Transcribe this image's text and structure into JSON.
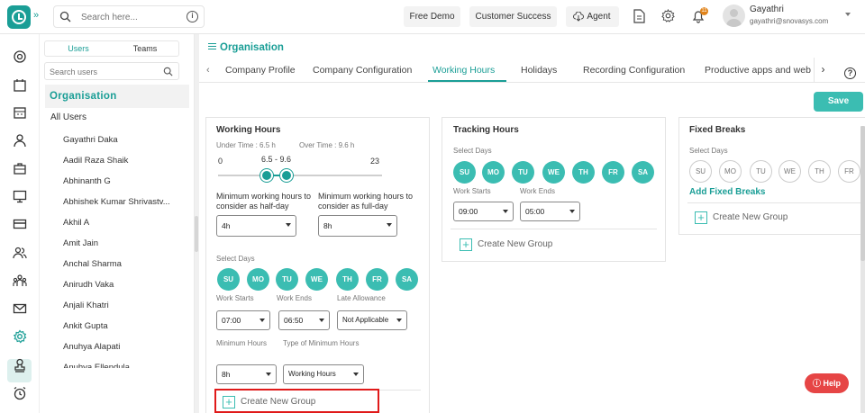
{
  "header": {
    "search_placeholder": "Search here...",
    "buttons": [
      "Free Demo",
      "Customer Success",
      "Agent"
    ],
    "notification_count": "11",
    "user_name": "Gayathri",
    "user_email": "gayathri@snovasys.com"
  },
  "sidebar": {
    "tabs": [
      "Users",
      "Teams"
    ],
    "search_placeholder": "Search users",
    "org_label": "Organisation",
    "all_users_label": "All Users",
    "users": [
      "Gayathri Daka",
      "Aadil Raza Shaik",
      "Abhinanth G",
      "Abhishek Kumar Shrivastv...",
      "Akhil A",
      "Amit Jain",
      "Anchal Sharma",
      "Anirudh Vaka",
      "Anjali Khatri",
      "Ankit Gupta",
      "Anuhya Alapati",
      "Anuhya Ellendula"
    ]
  },
  "page": {
    "title": "Organisation",
    "tabs": [
      "Company Profile",
      "Company Configuration",
      "Working Hours",
      "Holidays",
      "Recording Configuration",
      "Productive apps and web"
    ],
    "active_tab": "Working Hours",
    "save_label": "Save",
    "help_label": "Help"
  },
  "working_hours": {
    "title": "Working Hours",
    "under_time": "Under Time : 6.5 h",
    "over_time": "Over Time : 9.6 h",
    "slider_min": "0",
    "slider_range": "6.5 - 9.6",
    "slider_max": "23",
    "min_half_label": "Minimum working hours to consider as half-day",
    "min_half_value": "4h",
    "min_full_label": "Minimum working hours to consider as full-day",
    "min_full_value": "8h",
    "select_days_label": "Select Days",
    "days": [
      "SU",
      "MO",
      "TU",
      "WE",
      "TH",
      "FR",
      "SA"
    ],
    "work_starts_label": "Work Starts",
    "work_ends_label": "Work Ends",
    "late_allowance_label": "Late Allowance",
    "work_starts": "07:00",
    "work_ends": "06:50",
    "late_allowance": "Not Applicable",
    "minimum_hours_label": "Minimum Hours",
    "type_minimum_label": "Type of Minimum Hours",
    "minimum_hours": "8h",
    "type_minimum": "Working Hours",
    "create_group": "Create New Group"
  },
  "tracking_hours": {
    "title": "Tracking Hours",
    "select_days_label": "Select Days",
    "days": [
      "SU",
      "MO",
      "TU",
      "WE",
      "TH",
      "FR",
      "SA"
    ],
    "work_starts_label": "Work Starts",
    "work_ends_label": "Work Ends",
    "work_starts": "09:00",
    "work_ends": "05:00",
    "create_group": "Create New Group"
  },
  "fixed_breaks": {
    "title": "Fixed Breaks",
    "select_days_label": "Select Days",
    "days": [
      "SU",
      "MO",
      "TU",
      "WE",
      "TH",
      "FR"
    ],
    "add_label": "Add Fixed Breaks",
    "create_group": "Create New Group"
  },
  "colors": {
    "accent": "#1a9e96",
    "day_on": "#3bbdb2",
    "help": "#e64545",
    "highlight": "#e01a1a"
  }
}
